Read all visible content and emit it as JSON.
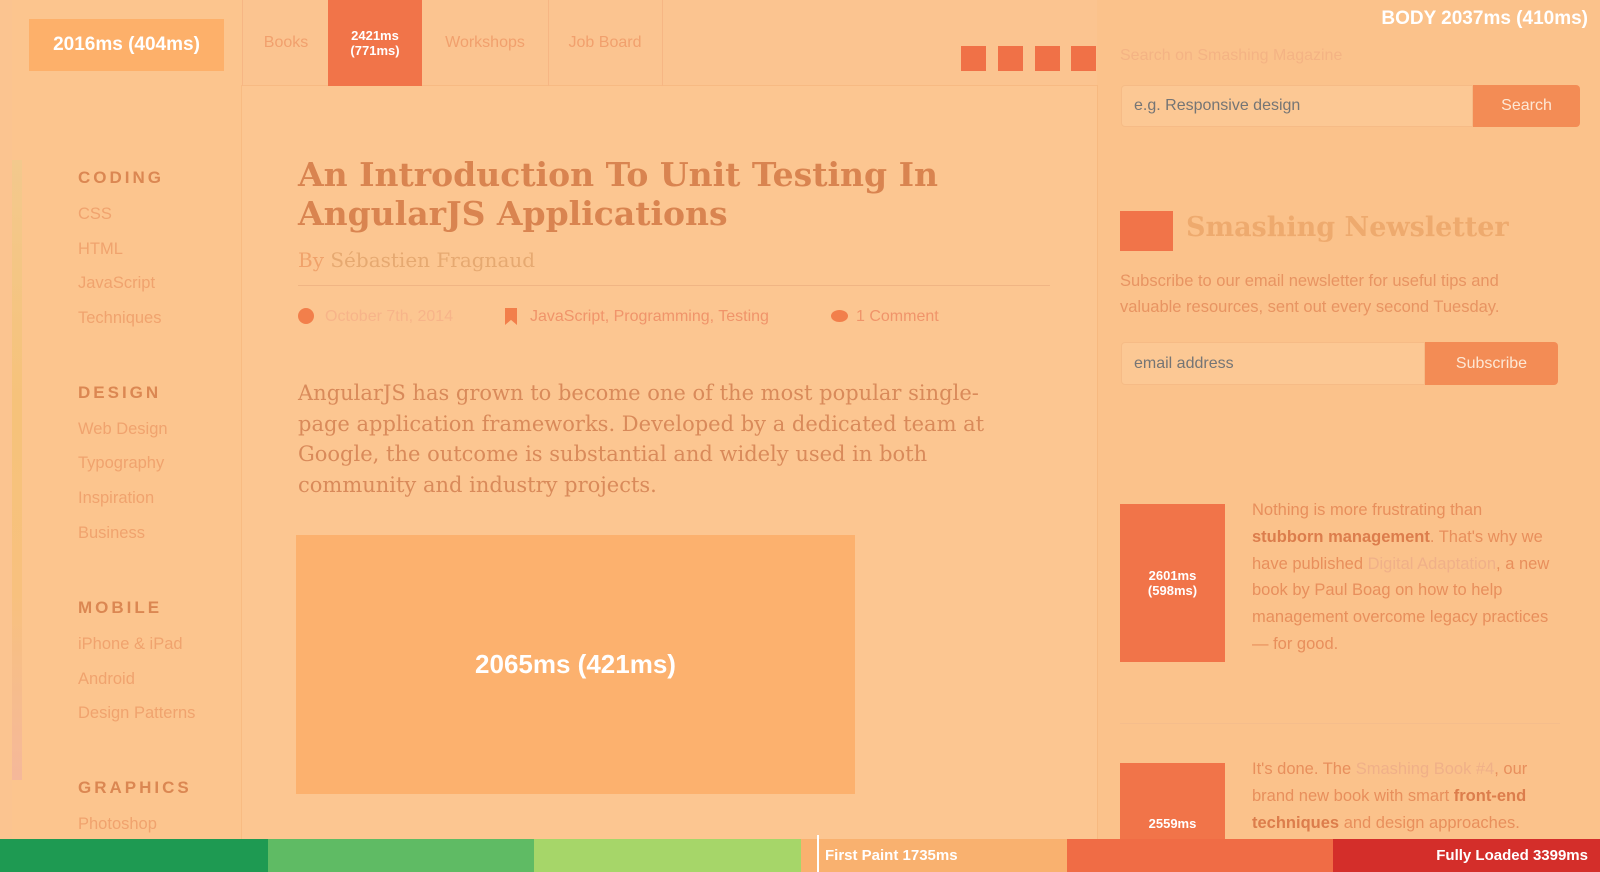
{
  "header": {
    "timing_badge": "2016ms (404ms)",
    "nav": [
      {
        "label": "Books"
      },
      {
        "label": "2421ms\n(771ms)",
        "line1": "2421ms",
        "line2": "(771ms)"
      },
      {
        "label": "Workshops"
      },
      {
        "label": "Job Board"
      }
    ],
    "body_timer": "BODY 2037ms (410ms)",
    "search": {
      "label": "Search on Smashing Magazine",
      "placeholder": "e.g. Responsive design",
      "button": "Search"
    }
  },
  "sidebar": {
    "sections": [
      {
        "heading": "CODING",
        "items": [
          "CSS",
          "HTML",
          "JavaScript",
          "Techniques"
        ]
      },
      {
        "heading": "DESIGN",
        "items": [
          "Web Design",
          "Typography",
          "Inspiration",
          "Business"
        ]
      },
      {
        "heading": "MOBILE",
        "items": [
          "iPhone & iPad",
          "Android",
          "Design Patterns"
        ]
      },
      {
        "heading": "GRAPHICS",
        "items": [
          "Photoshop"
        ]
      }
    ]
  },
  "article": {
    "title": "An Introduction To Unit Testing In AngularJS Applications",
    "by": "By",
    "author": "Sébastien Fragnaud",
    "date": "October 7th, 2014",
    "tags": "JavaScript, Programming, Testing",
    "comments": "1 Comment",
    "intro": "AngularJS has grown to become one of the most popular single-page application frameworks. Developed by a dedicated team at Google, the outcome is substantial and widely used in both community and industry projects.",
    "hero_timing": "2065ms (421ms)"
  },
  "newsletter": {
    "title": "Smashing Newsletter",
    "description": "Subscribe to our email newsletter for useful tips and valuable resources, sent out every second Tuesday.",
    "email_placeholder": "email address",
    "button": "Subscribe"
  },
  "promos": [
    {
      "timing_line1": "2601ms",
      "timing_line2": "(598ms)",
      "text_before": "Nothing is more frustrating than ",
      "bold": "stubborn management",
      "text_mid": ". That's why we have published ",
      "link": "Digital Adaptation",
      "text_after": ", a new book by Paul Boag on how to help management overcome legacy practices — for good."
    },
    {
      "timing_line1": "2559ms",
      "text_before": "It's done. The ",
      "link": "Smashing Book #4",
      "text_mid": ", our brand new book with smart ",
      "bold": "front-end techniques",
      "text_after": " and design approaches."
    }
  ],
  "timeline": {
    "first_paint": "First Paint 1735ms",
    "fully_loaded": "Fully Loaded 3399ms",
    "colors": [
      "#1e9a52",
      "#5fbb64",
      "#a6d669",
      "#f9b16f",
      "#f06c45",
      "#d42e2a"
    ]
  }
}
